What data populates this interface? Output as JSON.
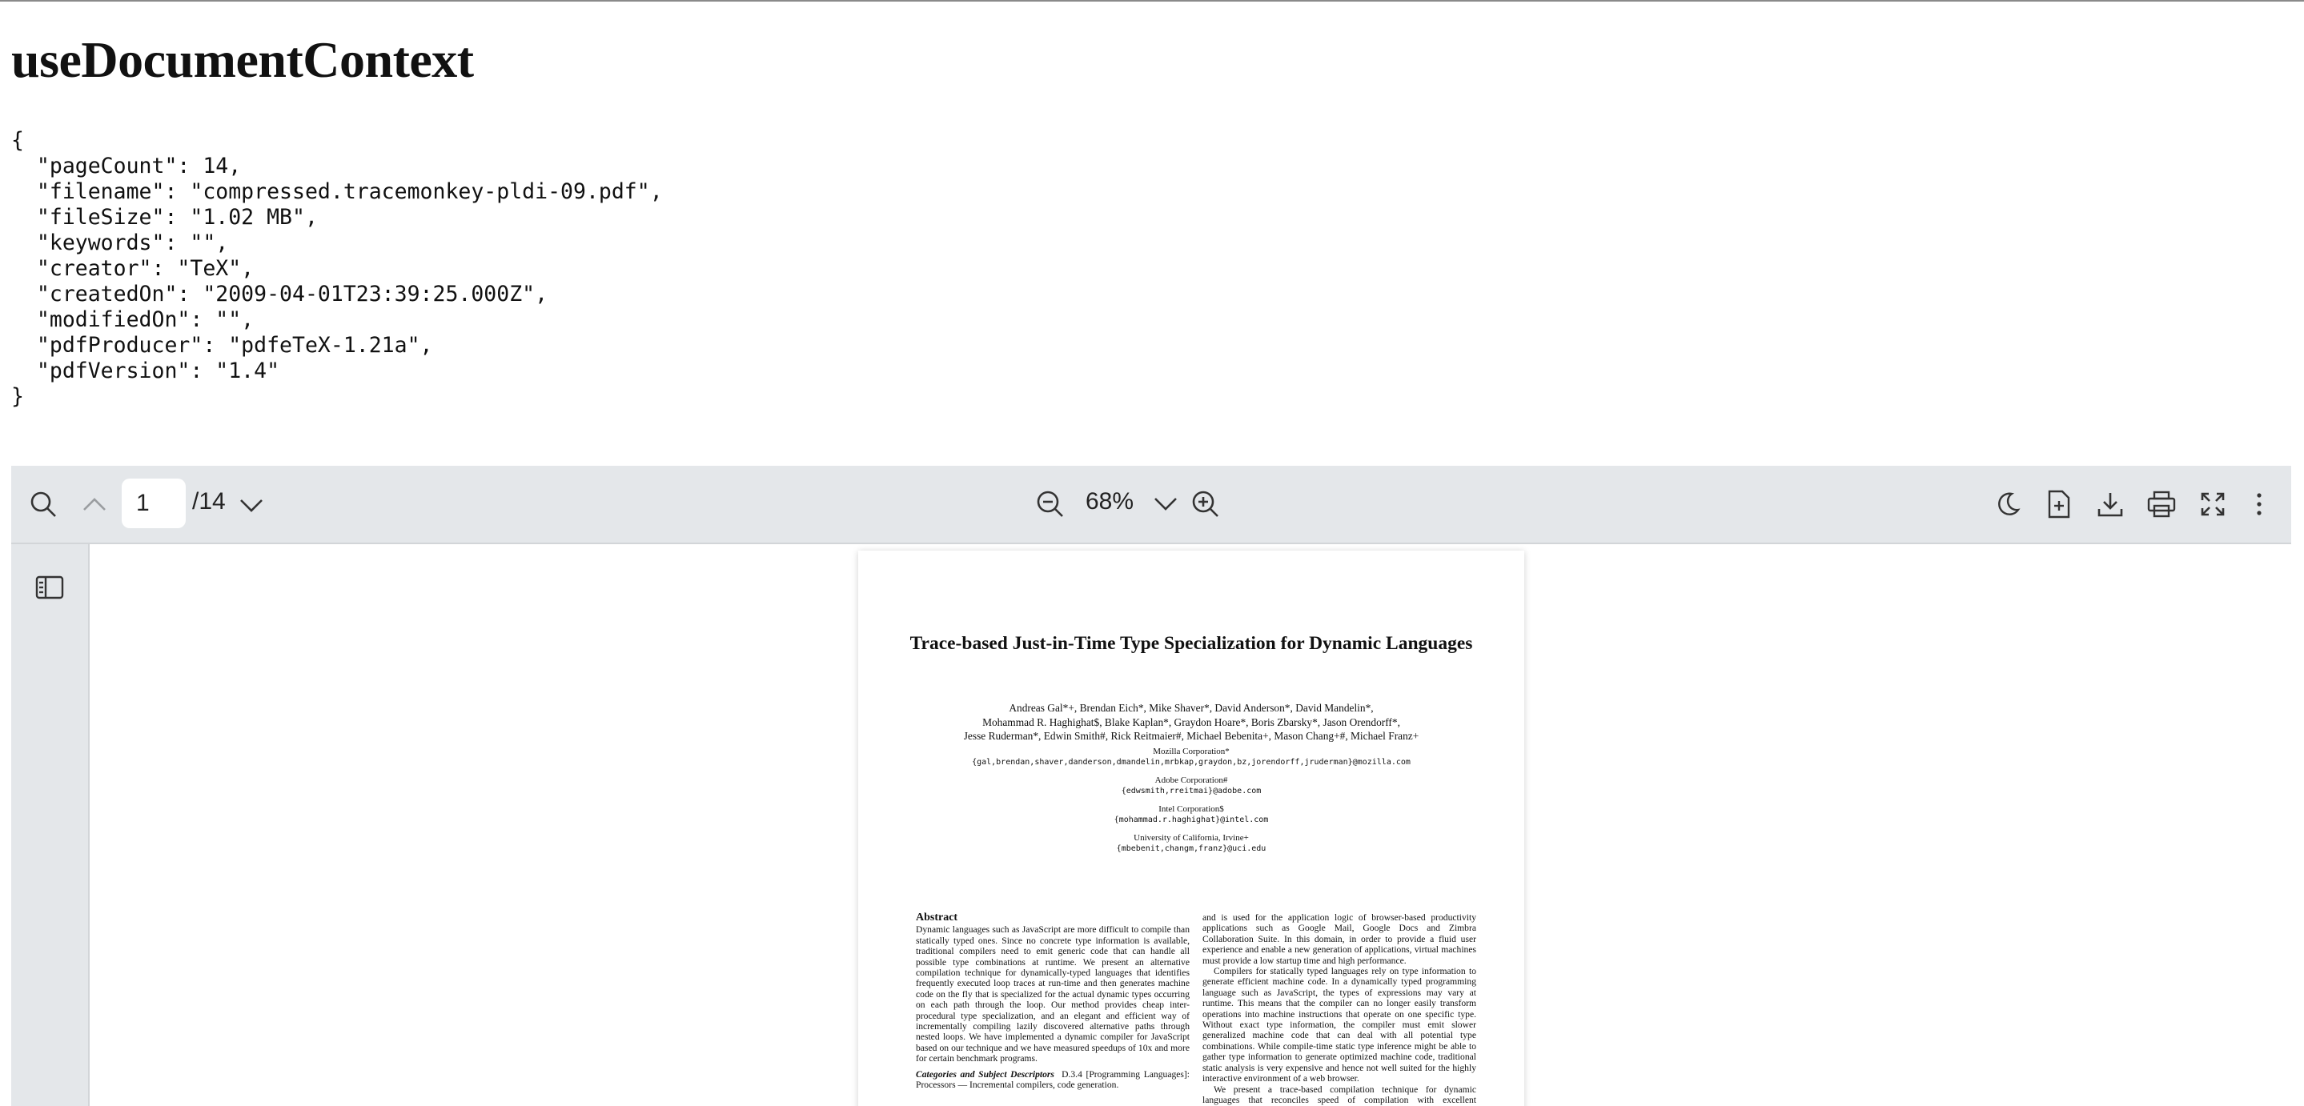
{
  "page_title": "useDocumentContext",
  "document_json": "{\n  \"pageCount\": 14,\n  \"filename\": \"compressed.tracemonkey-pldi-09.pdf\",\n  \"fileSize\": \"1.02 MB\",\n  \"keywords\": \"\",\n  \"creator\": \"TeX\",\n  \"createdOn\": \"2009-04-01T23:39:25.000Z\",\n  \"modifiedOn\": \"\",\n  \"pdfProducer\": \"pdfeTeX-1.21a\",\n  \"pdfVersion\": \"1.4\"\n}",
  "toolbar": {
    "page_value": "1",
    "page_total": "/14",
    "zoom": "68%",
    "icons": [
      "search-icon",
      "chevron-up-icon",
      "chevron-down-icon",
      "zoom-out-icon",
      "zoom-in-icon",
      "moon-icon",
      "file-plus-icon",
      "download-icon",
      "print-icon",
      "fullscreen-icon",
      "more-vertical-icon"
    ]
  },
  "sidebar": {
    "icons": [
      "thumbnails-icon"
    ]
  },
  "pdf_page": {
    "title": "Trace-based Just-in-Time Type Specialization for Dynamic Languages",
    "authors_line1": "Andreas Gal*+, Brendan Eich*, Mike Shaver*, David Anderson*, David Mandelin*,",
    "authors_line2": "Mohammad R. Haghighat$, Blake Kaplan*, Graydon Hoare*, Boris Zbarsky*, Jason Orendorff*,",
    "authors_line3": "Jesse Ruderman*, Edwin Smith#, Rick Reitmaier#, Michael Bebenita+, Mason Chang+#, Michael Franz+",
    "affil1_name": "Mozilla Corporation*",
    "affil1_email": "{gal,brendan,shaver,danderson,dmandelin,mrbkap,graydon,bz,jorendorff,jruderman}@mozilla.com",
    "affil2_name": "Adobe Corporation#",
    "affil2_email": "{edwsmith,rreitmai}@adobe.com",
    "affil3_name": "Intel Corporation$",
    "affil3_email": "{mohammad.r.haghighat}@intel.com",
    "affil4_name": "University of California, Irvine+",
    "affil4_email": "{mbebenit,changm,franz}@uci.edu",
    "abstract_heading": "Abstract",
    "abstract_text": "Dynamic languages such as JavaScript are more difficult to compile than statically typed ones. Since no concrete type information is available, traditional compilers need to emit generic code that can handle all possible type combinations at runtime. We present an alternative compilation technique for dynamically-typed languages that identifies frequently executed loop traces at run-time and then generates machine code on the fly that is specialized for the actual dynamic types occurring on each path through the loop. Our method provides cheap inter-procedural type specialization, and an elegant and efficient way of incrementally compiling lazily discovered alternative paths through nested loops. We have implemented a dynamic compiler for JavaScript based on our technique and we have measured speedups of 10x and more for certain benchmark programs.",
    "categories_heading": "Categories and Subject Descriptors",
    "categories_text": "D.3.4 [Programming Languages]: Processors — Incremental compilers, code generation.",
    "right_para1": "and is used for the application logic of browser-based productivity applications such as Google Mail, Google Docs and Zimbra Collaboration Suite. In this domain, in order to provide a fluid user experience and enable a new generation of applications, virtual machines must provide a low startup time and high performance.",
    "right_para2": "Compilers for statically typed languages rely on type information to generate efficient machine code. In a dynamically typed programming language such as JavaScript, the types of expressions may vary at runtime. This means that the compiler can no longer easily transform operations into machine instructions that operate on one specific type. Without exact type information, the compiler must emit slower generalized machine code that can deal with all potential type combinations. While compile-time static type inference might be able to gather type information to generate optimized machine code, traditional static analysis is very expensive and hence not well suited for the highly interactive environment of a web browser.",
    "right_para3": "We present a trace-based compilation technique for dynamic languages that reconciles speed of compilation with excellent performance of the generated machine code."
  }
}
